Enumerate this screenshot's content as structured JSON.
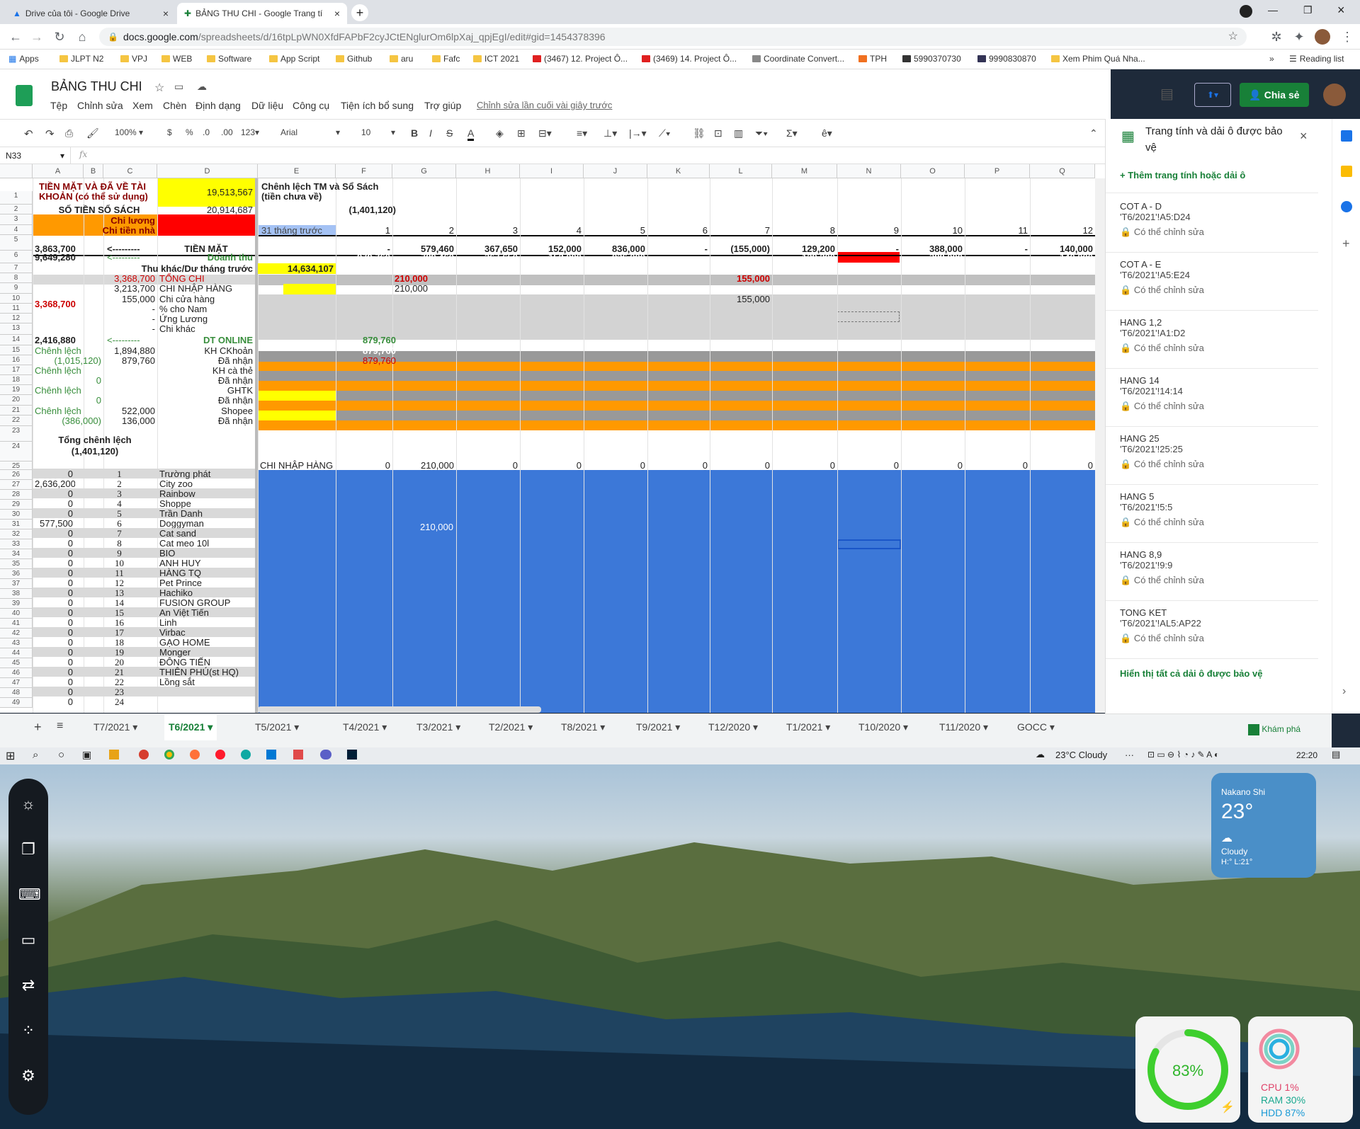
{
  "browser": {
    "tabs": [
      {
        "title": "Drive của tôi - Google Drive"
      },
      {
        "title": "BẢNG THU CHI - Google Trang tí"
      }
    ],
    "url_host": "docs.google.com",
    "url_path": "/spreadsheets/d/16tpLpWN0XfdFAPbF2cyJCtENglurOm6lpXaj_qpjEgI/edit#gid=1454378396",
    "bookmarks": [
      "Apps",
      "JLPT N2",
      "VPJ",
      "WEB",
      "Software",
      "App Script",
      "Github",
      "aru",
      "Fafc",
      "ICT 2021",
      "(3467) 12. Project Ô...",
      "(3469) 14. Project Ô...",
      "Coordinate Convert...",
      "TPH",
      "5990370730",
      "9990830870",
      "Xem Phim Quá Nha..."
    ],
    "reading_list": "Reading list"
  },
  "sheets": {
    "title": "BẢNG THU CHI",
    "menu": [
      "Tệp",
      "Chỉnh sửa",
      "Xem",
      "Chèn",
      "Định dạng",
      "Dữ liệu",
      "Công cụ",
      "Tiện ích bổ sung",
      "Trợ giúp"
    ],
    "last_edit": "Chỉnh sửa lần cuối vài giây trước",
    "share_label": "Chia sẻ",
    "toolbar": {
      "zoom": "100%",
      "currency": "$",
      "percent": "%",
      "dec0": ".0",
      "dec00": ".00",
      "format": "123",
      "font": "Arial",
      "size": "10"
    },
    "name_box": "N33",
    "fx": "fx"
  },
  "grid": {
    "columns": [
      "A",
      "B",
      "C",
      "D",
      "E",
      "F",
      "G",
      "H",
      "I",
      "J",
      "K",
      "L",
      "M",
      "N",
      "O",
      "P",
      "Q"
    ],
    "rows": [
      "1",
      "2",
      "3",
      "4",
      "5",
      "6",
      "7",
      "8",
      "9",
      "10",
      "11",
      "12",
      "13",
      "14",
      "15",
      "16",
      "17",
      "18",
      "19",
      "20",
      "21",
      "22",
      "23",
      "24",
      "25",
      "26",
      "27",
      "28",
      "29",
      "30",
      "31",
      "32",
      "33",
      "34",
      "35",
      "36",
      "37",
      "38",
      "39",
      "40",
      "41",
      "42",
      "43",
      "44",
      "45",
      "46",
      "47",
      "48",
      "49"
    ],
    "cells": {
      "a1": "TIỀN MẶT VÀ ĐÃ VỀ TÀI",
      "a1b": "KHOẢN (có thể sử dụng)",
      "d1": "19,513,567",
      "e1": "Chênh lệch TM và Sổ Sách",
      "e1b": "(tiền chưa về)",
      "a2": "SỐ TIỀN SỔ SÁCH",
      "d2": "20,914,687",
      "f2": "(1,401,120)",
      "c3": "Chi lương",
      "c3b": "Chi tiền nhà",
      "e4": "31 tháng trước",
      "month_nums": [
        "1",
        "2",
        "3",
        "4",
        "5",
        "6",
        "7",
        "8",
        "9",
        "10",
        "11",
        "12"
      ],
      "a5": "3,863,700",
      "b5": "<---------",
      "d5": "TIỀN MẶT",
      "row5": [
        "-",
        "579,460",
        "367,650",
        "152,000",
        "836,000",
        "-",
        "(155,000)",
        "129,200",
        "-",
        "388,000",
        "-",
        "140,000"
      ],
      "a6": "9,649,280",
      "b6": "<---------",
      "d6": "Doanh thu",
      "row6": [
        "879,760",
        "789,460",
        "367,650",
        "152,000",
        "836,000",
        "",
        "",
        "129,200",
        "",
        "388,000",
        "",
        "140,000"
      ],
      "c7": "Thu khác/Dư tháng trước",
      "e7": "14,634,107",
      "c8": "3,368,700",
      "d8": "TỔNG CHI",
      "g8": "210,000",
      "l8": "155,000",
      "c9": "3,213,700",
      "d9": "CHI NHẬP HÀNG",
      "g9": "210,000",
      "c10": "155,000",
      "d10": "Chi cửa hàng",
      "l10": "155,000",
      "a11": "3,368,700",
      "d11": "% cho Nam",
      "d12": "Ứng Lương",
      "d13": "Chi khác",
      "a14": "2,416,880",
      "b14": "<---------",
      "d14": "DT ONLINE",
      "f14": "879,760",
      "a15": "Chênh lệch",
      "c15": "1,894,880",
      "d15": "KH CKhoản",
      "f15": "879,760",
      "a16": "(1,015,120)",
      "c16": "879,760",
      "d16": "Đã nhận",
      "f16": "879,760",
      "a17": "Chênh lệch",
      "d17": "KH cà thẻ",
      "a18": "0",
      "d18": "Đã nhận",
      "a19": "Chênh lệch",
      "d19": "GHTK",
      "a20": "0",
      "d20": "Đã nhận",
      "a21": "Chênh lệch",
      "c21": "522,000",
      "d21": "Shopee",
      "a22": "(386,000)",
      "c22": "136,000",
      "d22": "Đã nhận",
      "a23": "Tổng chênh lệch",
      "a24": "(1,401,120)",
      "e25": "CHI NHẬP HÀNG",
      "row25": [
        "0",
        "210,000",
        "0",
        "0",
        "0",
        "0",
        "0",
        "0",
        "0",
        "0",
        "0",
        "0"
      ],
      "g31": "210,000",
      "a27": "2,636,200",
      "a31": "577,500",
      "dash": "-"
    },
    "suppliers": [
      "Trường phát",
      "City zoo",
      "Rainbow",
      "Shoppe",
      "Trần Danh",
      "Doggyman",
      "Cat sand",
      "Cat meo 10l",
      "BIO",
      "ANH  HUY",
      "HÀNG TQ",
      "Pet Prince",
      "Hachiko",
      "FUSION GROUP",
      "An Việt Tiến",
      "Linh",
      "Virbac",
      "GẠO HOME",
      "Monger",
      "ĐÔNG TIẾN",
      "THIÊN PHÚ(st HQ)",
      "Lồng sắt",
      "",
      ""
    ],
    "supplier_nums": [
      "1",
      "2",
      "3",
      "4",
      "5",
      "6",
      "7",
      "8",
      "9",
      "10",
      "11",
      "12",
      "13",
      "14",
      "15",
      "16",
      "17",
      "18",
      "19",
      "20",
      "21",
      "22",
      "23",
      "24"
    ],
    "a_list": [
      "0",
      "2,636,200",
      "0",
      "0",
      "0",
      "577,500",
      "0",
      "0",
      "0",
      "0",
      "0",
      "0",
      "0",
      "0",
      "0",
      "0",
      "0",
      "0",
      "0",
      "0",
      "0",
      "0",
      "0",
      "0"
    ]
  },
  "panel": {
    "title": "Trang tính và dải ô được bảo vệ",
    "add": "Thêm trang tính hoặc dải ô",
    "items": [
      {
        "name": "COT A - D",
        "range": "'T6/2021'!A5:D24"
      },
      {
        "name": "COT A - E",
        "range": "'T6/2021'!A5:E24"
      },
      {
        "name": "HANG 1,2",
        "range": "'T6/2021'!A1:D2"
      },
      {
        "name": "HANG 14",
        "range": "'T6/2021'!14:14"
      },
      {
        "name": "HANG 25",
        "range": "'T6/2021'!25:25"
      },
      {
        "name": "HANG 5",
        "range": "'T6/2021'!5:5"
      },
      {
        "name": "HANG 8,9",
        "range": "'T6/2021'!9:9"
      },
      {
        "name": "TONG KET",
        "range": "'T6/2021'!AL5:AP22"
      }
    ],
    "editable": "Có thể chỉnh sửa",
    "show_all": "Hiển thị tất cả dải ô được bảo vệ"
  },
  "sheet_tabs": [
    "T7/2021",
    "T6/2021",
    "T5/2021",
    "T4/2021",
    "T3/2021",
    "T2/2021",
    "T8/2021",
    "T9/2021",
    "T12/2020",
    "T1/2021",
    "T10/2020",
    "T11/2020",
    "GOCC"
  ],
  "explore": "Khám phá",
  "taskbar": {
    "weather": "23°C  Cloudy",
    "time": "22:20"
  },
  "widgets": {
    "weather": {
      "city": "Nakano Shi",
      "temp": "23°",
      "cond": "Cloudy",
      "hl": "H:° L:21°"
    },
    "battery": "83%",
    "battery_level": 0.83,
    "cpu": "CPU 1%",
    "ram": "RAM 30%",
    "hdd": "HDD 87%"
  }
}
